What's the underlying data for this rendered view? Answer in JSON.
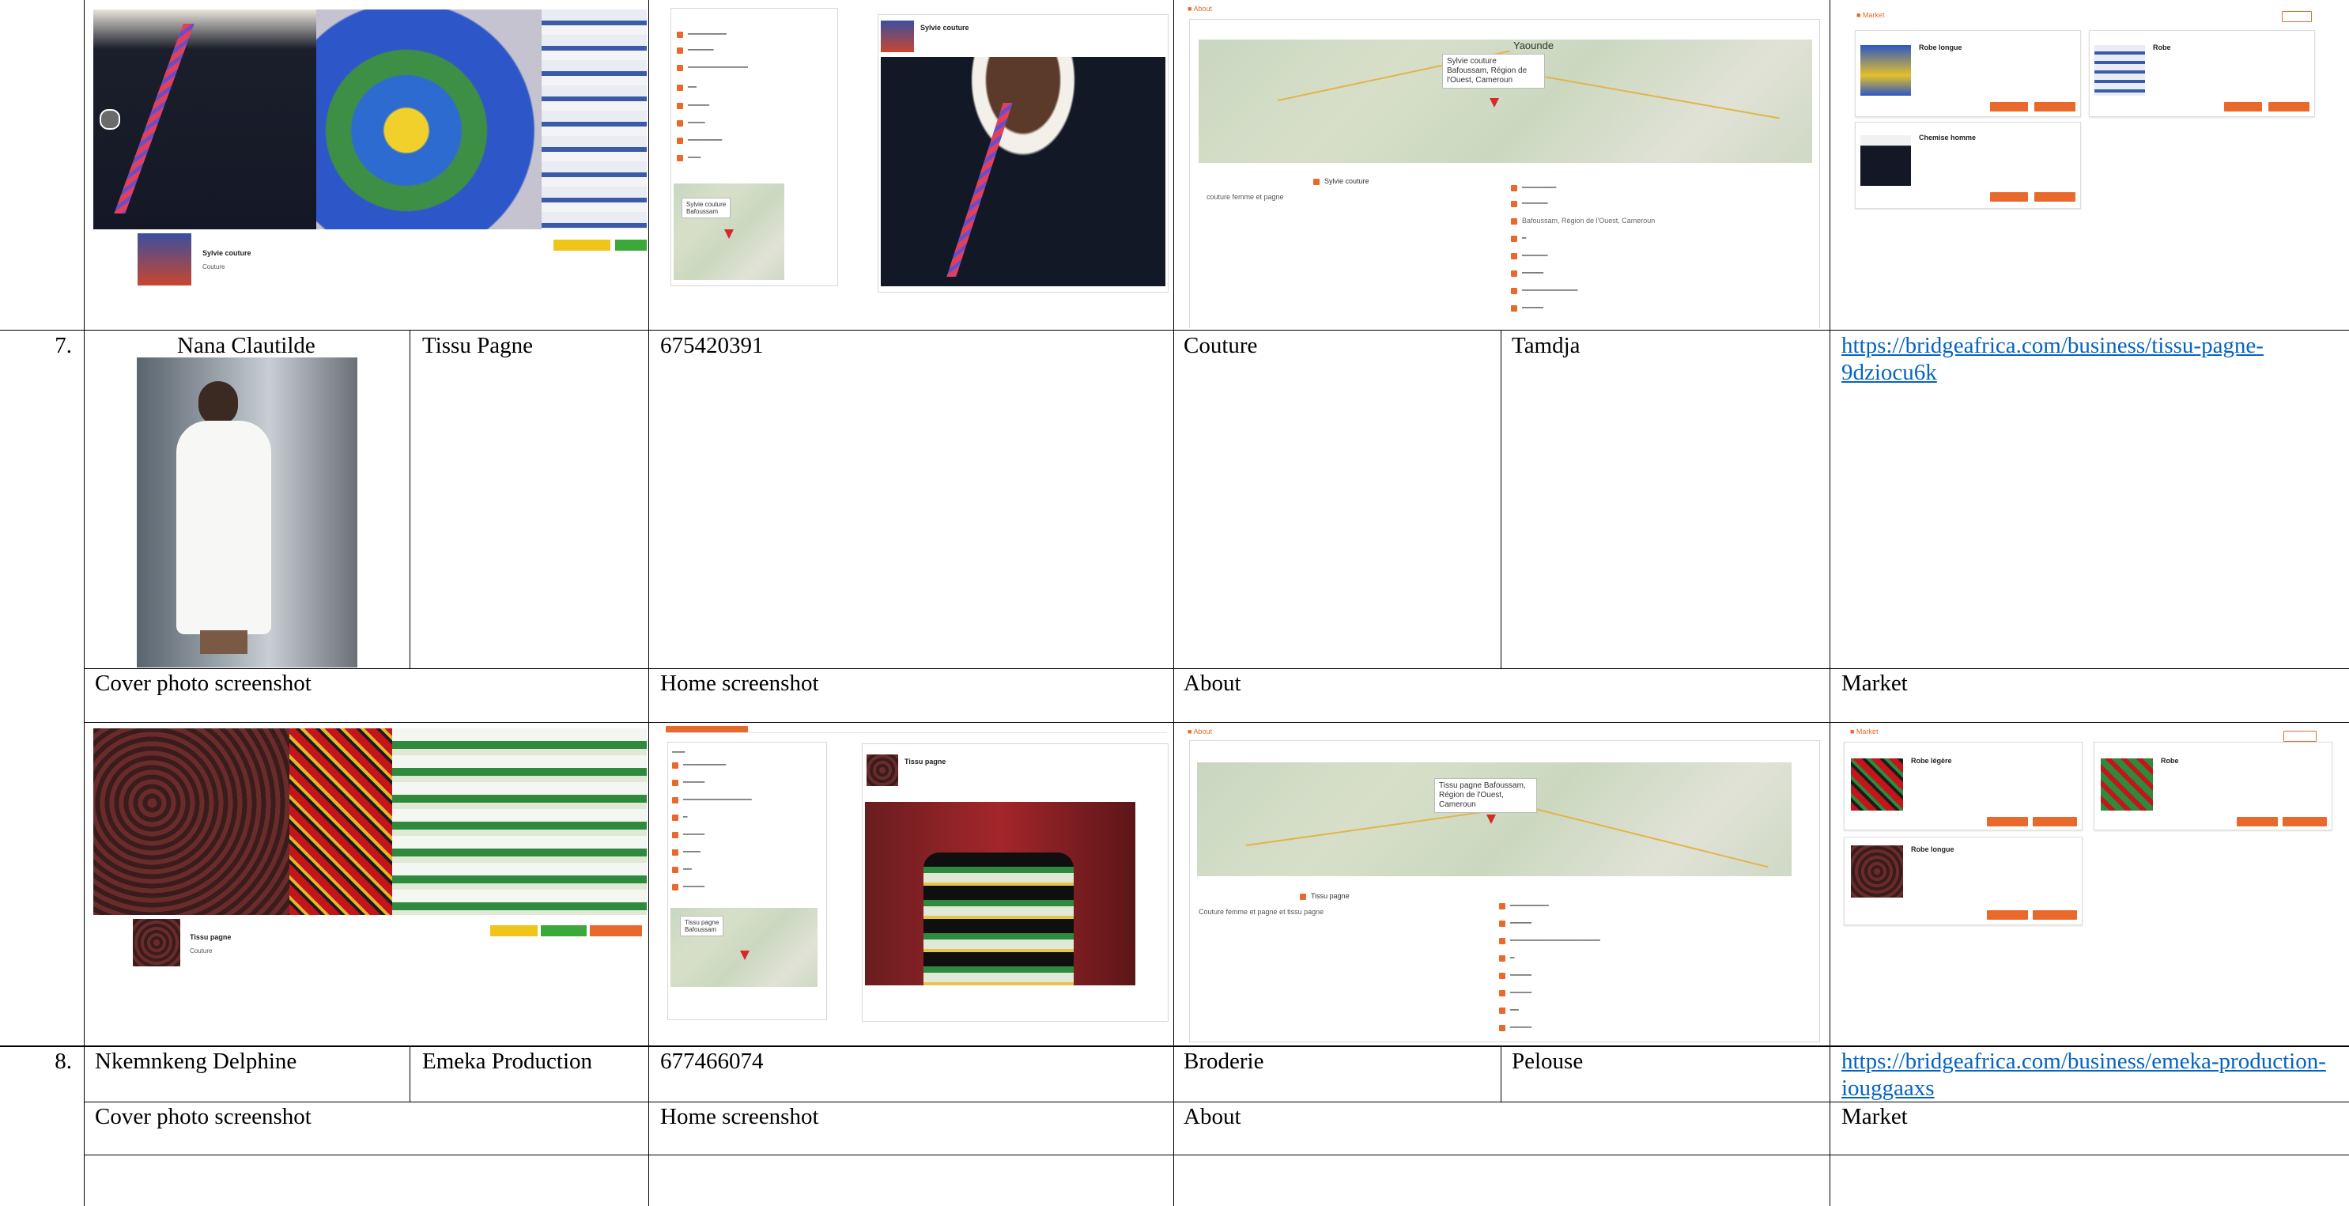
{
  "rows": [
    {
      "index": "7.",
      "name": "Nana Clautilde",
      "business": "Tissu Pagne",
      "phone": "675420391",
      "category": "Couture",
      "location": "Tamdja",
      "url": "https://bridgeafrica.com/business/tissu-pagne-9dziocu6k",
      "url_line1": "https://bridgeafrica.com/business/tissu-pagne-",
      "url_line2": "9dziocu6k"
    },
    {
      "index": "8.",
      "name": "Nkemnkeng Delphine",
      "business": "Emeka Production",
      "phone": "677466074",
      "category": "Broderie",
      "location": "Pelouse",
      "url": "https://bridgeafrica.com/business/emeka-production-iouggaaxs",
      "url_line1": "https://bridgeafrica.com/business/emeka-production-",
      "url_line2": "iouggaaxs"
    }
  ],
  "headers": {
    "cover": "Cover photo screenshot",
    "home": "Home screenshot",
    "about": "About",
    "market": "Market"
  },
  "shot1": {
    "business_name": "Sylvie couture",
    "business_sub": "Couture",
    "map_title": "Yaounde",
    "map_label": "Sylvie couture Bafoussam, Région de l'Ouest, Cameroun",
    "about_line": "couture femme et pagne",
    "about_name": "Sylvie couture",
    "about_addr": "Bafoussam, Région de l'Ouest, Cameroun",
    "market_items": [
      "Robe longue",
      "Robe",
      "Chemise homme"
    ]
  },
  "shot2": {
    "business_name": "Tissu pagne",
    "business_sub": "Couture",
    "map_label": "Tissu pagne Bafoussam, Région de l'Ouest, Cameroun",
    "about_line": "Couture femme et pagne et tissu pagne",
    "about_name": "Tissu pagne",
    "market_items": [
      "Robe légère",
      "Robe",
      "Robe longue"
    ]
  },
  "colors": {
    "accent": "#e8692b",
    "link": "#0563c1",
    "yellow": "#f0c51a",
    "green": "#3aa93a"
  }
}
